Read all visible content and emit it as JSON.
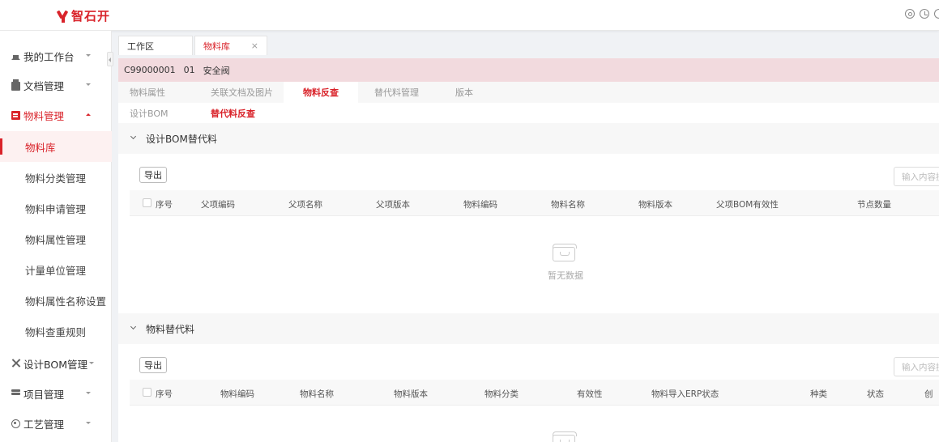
{
  "app": {
    "logo_text": "智石开"
  },
  "sidebar": {
    "items": [
      {
        "label": "我的工作台"
      },
      {
        "label": "文档管理"
      },
      {
        "label": "物料管理"
      },
      {
        "label": "设计BOM管理"
      },
      {
        "label": "项目管理"
      },
      {
        "label": "工艺管理"
      }
    ],
    "sub_items": [
      {
        "label": "物料库"
      },
      {
        "label": "物料分类管理"
      },
      {
        "label": "物料申请管理"
      },
      {
        "label": "物料属性管理"
      },
      {
        "label": "计量单位管理"
      },
      {
        "label": "物料属性名称设置"
      },
      {
        "label": "物料查重规则"
      }
    ]
  },
  "tabs": [
    {
      "label": "工作区"
    },
    {
      "label": "物料库",
      "close": "×"
    }
  ],
  "material": {
    "code": "C99000001",
    "version": "01",
    "name": "安全阀"
  },
  "subtabs": [
    {
      "label": "物料属性"
    },
    {
      "label": "关联文档及图片"
    },
    {
      "label": "物料反查"
    },
    {
      "label": "替代料管理"
    },
    {
      "label": "版本"
    }
  ],
  "subtabs2": [
    {
      "label": "设计BOM"
    },
    {
      "label": "替代料反查"
    }
  ],
  "section1": {
    "title": "设计BOM替代料",
    "export_label": "导出",
    "search_placeholder": "输入内容搜索",
    "columns": [
      "序号",
      "父项编码",
      "父项名称",
      "父项版本",
      "物料编码",
      "物料名称",
      "物料版本",
      "父项BOM有效性",
      "节点数量"
    ],
    "empty_text": "暂无数据"
  },
  "section2": {
    "title": "物料替代料",
    "export_label": "导出",
    "search_placeholder": "输入内容搜索",
    "columns": [
      "序号",
      "物料编码",
      "物料名称",
      "物料版本",
      "物料分类",
      "有效性",
      "物料导入ERP状态",
      "种类",
      "状态",
      "创"
    ]
  }
}
